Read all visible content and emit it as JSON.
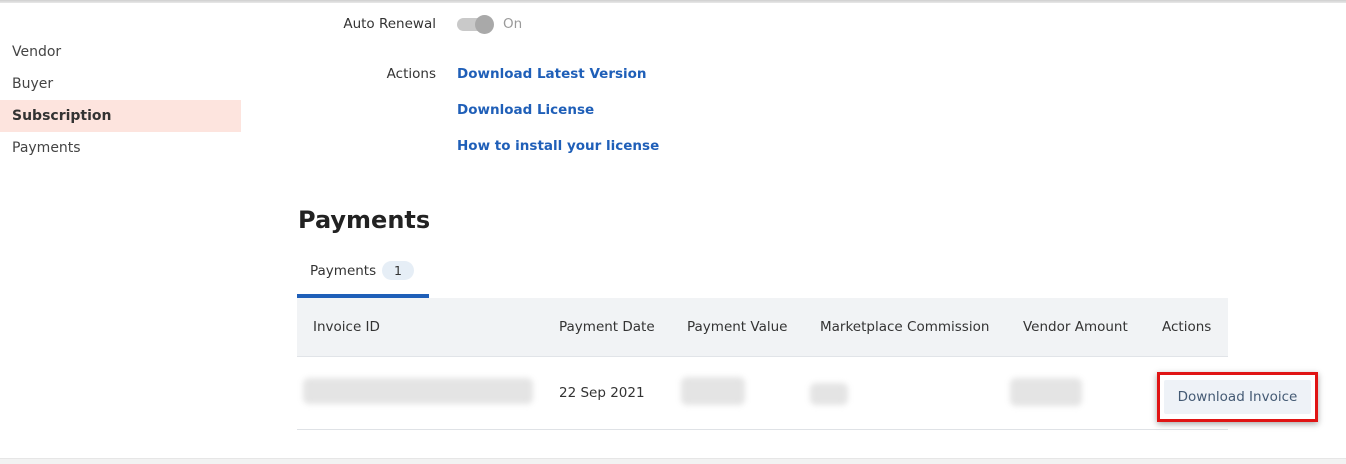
{
  "sidebar": {
    "items": [
      {
        "label": "Vendor",
        "active": false
      },
      {
        "label": "Buyer",
        "active": false
      },
      {
        "label": "Subscription",
        "active": true
      },
      {
        "label": "Payments",
        "active": false
      }
    ]
  },
  "details": {
    "auto_renewal_label": "Auto Renewal",
    "auto_renewal_state": "On",
    "actions_label": "Actions",
    "actions": [
      "Download Latest Version",
      "Download License",
      "How to install your license"
    ]
  },
  "payments": {
    "title": "Payments",
    "tab_label": "Payments",
    "tab_count": "1",
    "columns": [
      "Invoice ID",
      "Payment Date",
      "Payment Value",
      "Marketplace Commission",
      "Vendor Amount",
      "Actions"
    ],
    "rows": [
      {
        "payment_date": "22 Sep 2021",
        "action": "Download Invoice"
      }
    ]
  },
  "colors": {
    "accent": "#1f5fb8",
    "active_nav_bg": "#fde4de",
    "highlight_border": "#e01414"
  }
}
